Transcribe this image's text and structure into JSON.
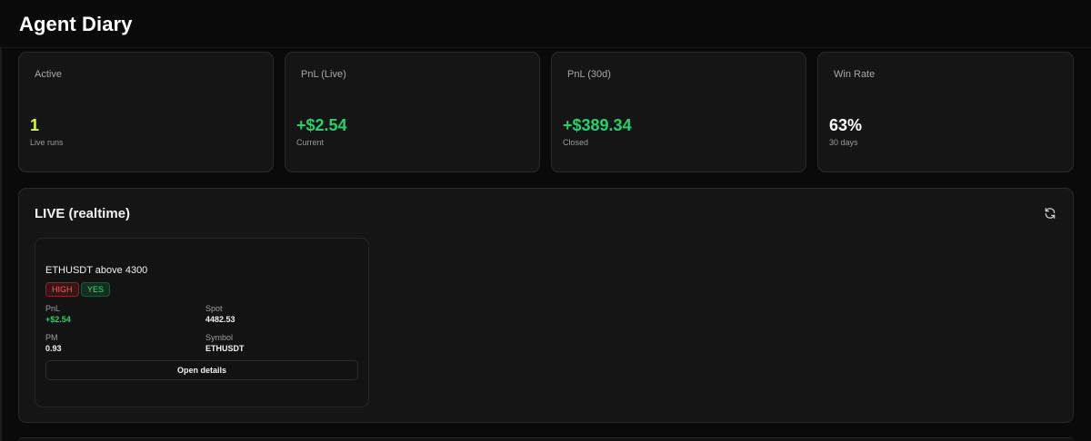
{
  "page": {
    "title": "Agent Diary"
  },
  "stats": [
    {
      "label": "Active",
      "value": "1",
      "sub": "Live runs",
      "color": "#d4ff2a"
    },
    {
      "label": "PnL (Live)",
      "value": "+$2.54",
      "sub": "Current",
      "color": "#22d36b"
    },
    {
      "label": "PnL (30d)",
      "value": "+$389.34",
      "sub": "Closed",
      "color": "#22d36b"
    },
    {
      "label": "Win Rate",
      "value": "63%",
      "sub": "30 days",
      "color": "#ffffff"
    }
  ],
  "live": {
    "title": "LIVE (realtime)",
    "refresh_icon": "refresh-icon",
    "runs": [
      {
        "title": "ETHUSDT above 4300",
        "badges": [
          "HIGH",
          "YES"
        ],
        "pnl_label": "PnL",
        "pnl_value": "+$2.54",
        "spot_label": "Spot",
        "spot_value": "4482.53",
        "pm_label": "PM",
        "pm_value": "0.93",
        "symbol_label": "Symbol",
        "symbol_value": "ETHUSDT",
        "details_label": "Open details"
      }
    ]
  }
}
